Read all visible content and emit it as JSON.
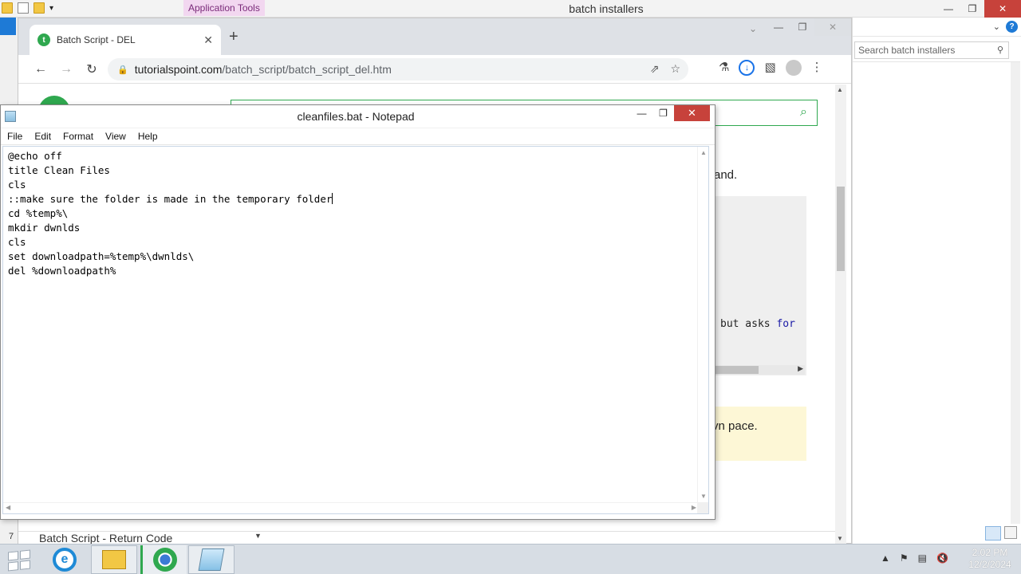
{
  "explorer": {
    "contextual_tab": "Application Tools",
    "title": "batch installers",
    "minimize_label": "—",
    "maximize_label": "❐",
    "close_label": "✕",
    "search_placeholder": "Search batch installers",
    "help_label": "?",
    "icons": [
      "folder-icon",
      "document-icon",
      "chevron-down-icon",
      "search-icon",
      "help-icon",
      "details-view-icon",
      "large-icons-view-icon"
    ]
  },
  "browser": {
    "tab_title": "Batch Script - DEL",
    "favicon_letter": "t",
    "tab_close": "✕",
    "new_tab": "+",
    "url_host": "tutorialspoint.com",
    "url_path": "/batch_script/batch_script_del.htm",
    "back": "←",
    "forward": "→",
    "reload": "↻",
    "share": "⇗",
    "star": "☆",
    "labs": "⚗",
    "download": "↓",
    "sidepanel": "▧",
    "menu": "⋮",
    "tab_dropdown": "⌄"
  },
  "page": {
    "text_1": "and.",
    "code_fragment_1": "but asks",
    "code_fragment_2": "for",
    "note_text": "vn pace.",
    "list_number": "7",
    "list_item": "Batch Script - Return Code",
    "search_icon": "⌕"
  },
  "notepad": {
    "title": "cleanfiles.bat - Notepad",
    "menu": [
      "File",
      "Edit",
      "Format",
      "View",
      "Help"
    ],
    "lines": [
      "@echo off",
      "title Clean Files",
      "cls",
      "::make sure the folder is made in the temporary folder",
      "cd %temp%\\",
      "mkdir dwnlds",
      "cls",
      "set downloadpath=%temp%\\dwnlds\\",
      "del %downloadpath%"
    ]
  },
  "taskbar": {
    "clock_time": "2:02 PM",
    "clock_date": "12/2/2024",
    "tray_icons": [
      "show-hidden-icons-icon",
      "flag-icon",
      "network-icon",
      "volume-muted-icon"
    ]
  },
  "colors": {
    "accent_green": "#2fa84f",
    "close_red": "#c7423b",
    "chrome_blue": "#1a73e8"
  }
}
